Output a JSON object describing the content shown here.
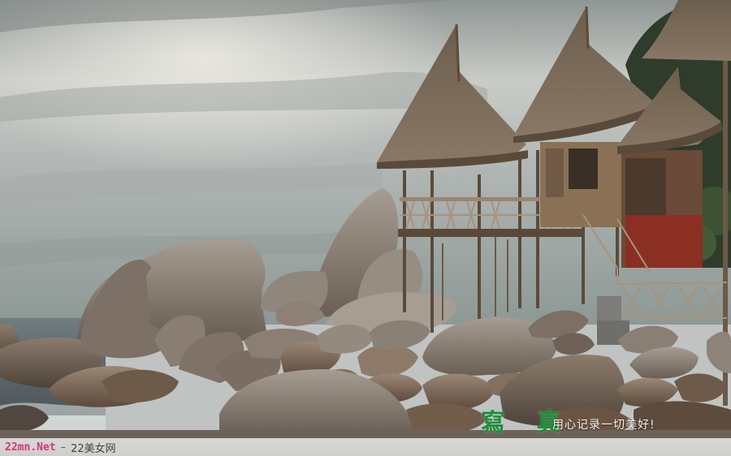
{
  "watermark": {
    "title": "寫 真",
    "motto": "用心记录一切美好!"
  },
  "footer": {
    "site": "22mn.Net",
    "separator": "–",
    "name": "22美女网"
  }
}
